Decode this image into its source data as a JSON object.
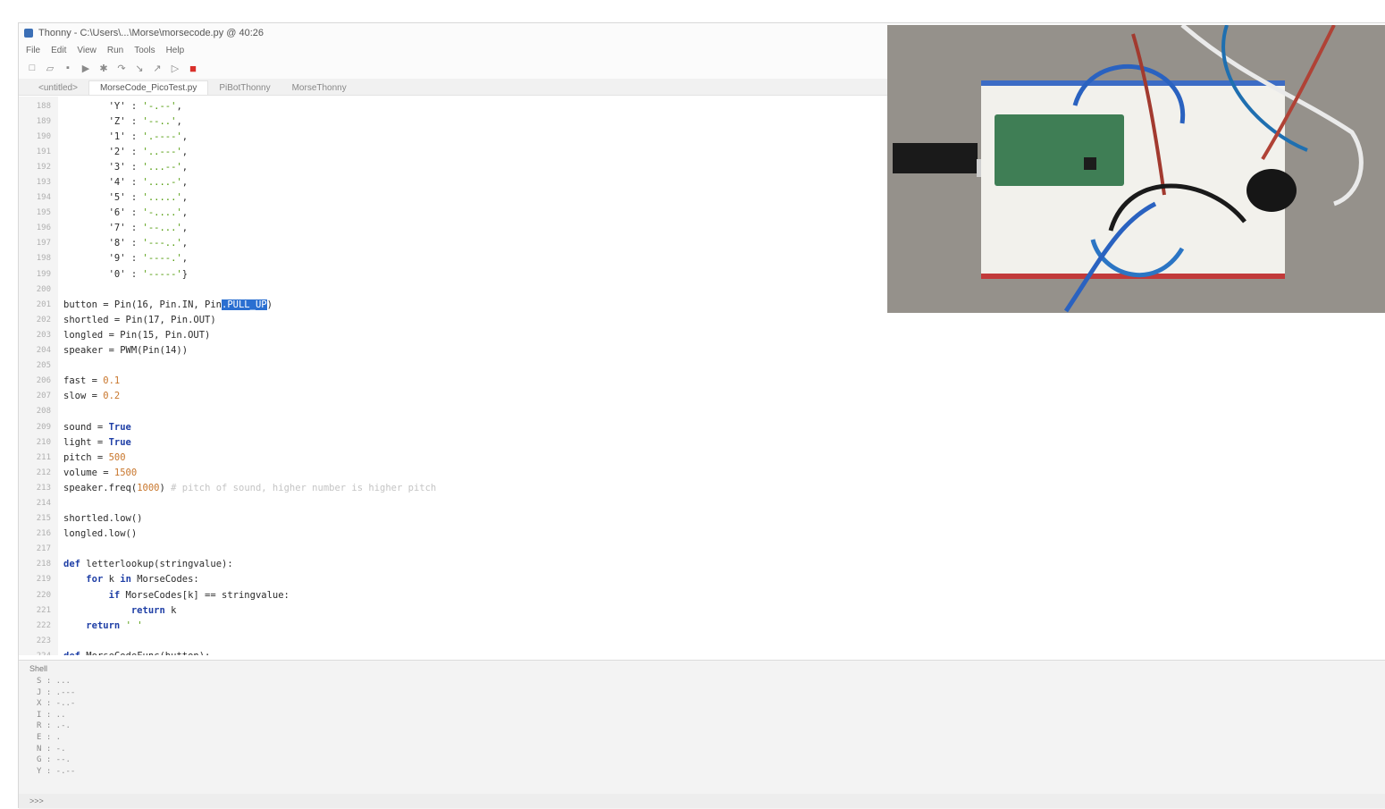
{
  "window": {
    "title": "Thonny - C:\\Users\\...\\Morse\\morsecode.py @ 40:26",
    "menu": [
      "File",
      "Edit",
      "View",
      "Run",
      "Tools",
      "Help"
    ]
  },
  "tabs": [
    "<untitled>",
    "MorseCode_PicoTest.py",
    "PiBotThonny",
    "MorseThonny"
  ],
  "editor": {
    "lines": [
      {
        "n": "188",
        "segs": [
          [
            "code",
            "        'Y' : "
          ],
          [
            "str",
            "'-.--'"
          ],
          [
            "code",
            ","
          ]
        ]
      },
      {
        "n": "189",
        "segs": [
          [
            "code",
            "        'Z' : "
          ],
          [
            "str",
            "'--..'"
          ],
          [
            "code",
            ","
          ]
        ]
      },
      {
        "n": "190",
        "segs": [
          [
            "code",
            "        '1' : "
          ],
          [
            "str",
            "'.----'"
          ],
          [
            "code",
            ","
          ]
        ]
      },
      {
        "n": "191",
        "segs": [
          [
            "code",
            "        '2' : "
          ],
          [
            "str",
            "'..---'"
          ],
          [
            "code",
            ","
          ]
        ]
      },
      {
        "n": "192",
        "segs": [
          [
            "code",
            "        '3' : "
          ],
          [
            "str",
            "'...--'"
          ],
          [
            "code",
            ","
          ]
        ]
      },
      {
        "n": "193",
        "segs": [
          [
            "code",
            "        '4' : "
          ],
          [
            "str",
            "'....-'"
          ],
          [
            "code",
            ","
          ]
        ]
      },
      {
        "n": "194",
        "segs": [
          [
            "code",
            "        '5' : "
          ],
          [
            "str",
            "'.....'"
          ],
          [
            "code",
            ","
          ]
        ]
      },
      {
        "n": "195",
        "segs": [
          [
            "code",
            "        '6' : "
          ],
          [
            "str",
            "'-....'"
          ],
          [
            "code",
            ","
          ]
        ]
      },
      {
        "n": "196",
        "segs": [
          [
            "code",
            "        '7' : "
          ],
          [
            "str",
            "'--...'"
          ],
          [
            "code",
            ","
          ]
        ]
      },
      {
        "n": "197",
        "segs": [
          [
            "code",
            "        '8' : "
          ],
          [
            "str",
            "'---..'"
          ],
          [
            "code",
            ","
          ]
        ]
      },
      {
        "n": "198",
        "segs": [
          [
            "code",
            "        '9' : "
          ],
          [
            "str",
            "'----.'"
          ],
          [
            "code",
            ","
          ]
        ]
      },
      {
        "n": "199",
        "segs": [
          [
            "code",
            "        '0' : "
          ],
          [
            "str",
            "'-----'"
          ],
          [
            "code",
            "}"
          ]
        ]
      },
      {
        "n": "200",
        "segs": []
      },
      {
        "n": "201",
        "segs": [
          [
            "code",
            "button = Pin(16, Pin.IN, Pin"
          ],
          [
            "sel",
            ".PULL_UP"
          ],
          [
            "code",
            ")"
          ]
        ]
      },
      {
        "n": "202",
        "segs": [
          [
            "code",
            "shortled = Pin(17, Pin.OUT)"
          ]
        ]
      },
      {
        "n": "203",
        "segs": [
          [
            "code",
            "longled = Pin(15, Pin.OUT)"
          ]
        ]
      },
      {
        "n": "204",
        "segs": [
          [
            "code",
            "speaker = PWM(Pin(14))"
          ]
        ]
      },
      {
        "n": "205",
        "segs": []
      },
      {
        "n": "206",
        "segs": [
          [
            "code",
            "fast = "
          ],
          [
            "num",
            "0.1"
          ]
        ]
      },
      {
        "n": "207",
        "segs": [
          [
            "code",
            "slow = "
          ],
          [
            "num",
            "0.2"
          ]
        ]
      },
      {
        "n": "208",
        "segs": []
      },
      {
        "n": "209",
        "segs": [
          [
            "code",
            "sound = "
          ],
          [
            "kw",
            "True"
          ]
        ]
      },
      {
        "n": "210",
        "segs": [
          [
            "code",
            "light = "
          ],
          [
            "kw",
            "True"
          ]
        ]
      },
      {
        "n": "211",
        "segs": [
          [
            "code",
            "pitch = "
          ],
          [
            "num",
            "500"
          ]
        ]
      },
      {
        "n": "212",
        "segs": [
          [
            "code",
            "volume = "
          ],
          [
            "num",
            "1500"
          ]
        ]
      },
      {
        "n": "213",
        "segs": [
          [
            "code",
            "speaker.freq("
          ],
          [
            "num",
            "1000"
          ],
          [
            "code",
            ") "
          ],
          [
            "cmt",
            "# pitch of sound, higher number is higher pitch"
          ]
        ]
      },
      {
        "n": "214",
        "segs": []
      },
      {
        "n": "215",
        "segs": [
          [
            "code",
            "shortled.low()"
          ]
        ]
      },
      {
        "n": "216",
        "segs": [
          [
            "code",
            "longled.low()"
          ]
        ]
      },
      {
        "n": "217",
        "segs": []
      },
      {
        "n": "218",
        "segs": [
          [
            "kw",
            "def "
          ],
          [
            "code",
            "letterlookup(stringvalue):"
          ]
        ]
      },
      {
        "n": "219",
        "segs": [
          [
            "code",
            "    "
          ],
          [
            "kw",
            "for "
          ],
          [
            "code",
            "k "
          ],
          [
            "kw",
            "in "
          ],
          [
            "code",
            "MorseCodes:"
          ]
        ]
      },
      {
        "n": "220",
        "segs": [
          [
            "code",
            "        "
          ],
          [
            "kw",
            "if "
          ],
          [
            "code",
            "MorseCodes[k] == stringvalue:"
          ]
        ]
      },
      {
        "n": "221",
        "segs": [
          [
            "code",
            "            "
          ],
          [
            "kw",
            "return "
          ],
          [
            "code",
            "k"
          ]
        ]
      },
      {
        "n": "222",
        "segs": [
          [
            "code",
            "    "
          ],
          [
            "kw",
            "return "
          ],
          [
            "str",
            "' '"
          ]
        ]
      },
      {
        "n": "223",
        "segs": []
      },
      {
        "n": "224",
        "segs": [
          [
            "kw",
            "def "
          ],
          [
            "code",
            "MorseCodeFunc(button):"
          ]
        ]
      }
    ]
  },
  "shell": {
    "title": "Shell",
    "lines": [
      "S : ...",
      "J : .---",
      "X : -..-",
      "I : ..",
      "R : .-.",
      "E : .",
      "N : -.",
      "G : --.",
      "Y : -.--"
    ],
    "prompt": ">>>"
  },
  "colors": {
    "keyword": "#1f3fa6",
    "string": "#4e9a06",
    "number": "#c8762c",
    "selection": "#2a6fd1",
    "stop_button": "#d9302a"
  }
}
